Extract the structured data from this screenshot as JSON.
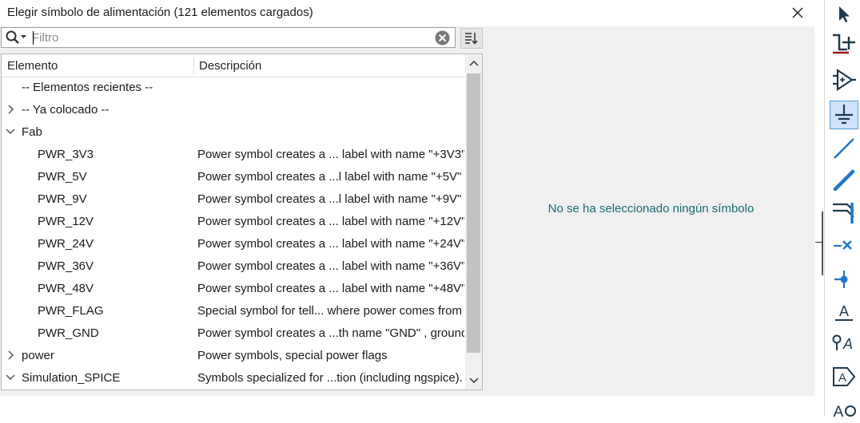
{
  "dialog": {
    "title": "Elegir símbolo de alimentación (121 elementos cargados)"
  },
  "filter": {
    "placeholder": "Filtro",
    "value": ""
  },
  "tree": {
    "columns": [
      "Elemento",
      "Descripción"
    ],
    "rows": [
      {
        "name": "-- Elementos recientes --",
        "desc": "",
        "level": 0,
        "arrow": "none"
      },
      {
        "name": "-- Ya colocado --",
        "desc": "",
        "level": 0,
        "arrow": "collapsed"
      },
      {
        "name": "Fab",
        "desc": "",
        "level": 0,
        "arrow": "expanded"
      },
      {
        "name": "PWR_3V3",
        "desc": "Power symbol creates a ... label with name \"+3V3\"",
        "level": 1,
        "arrow": "none"
      },
      {
        "name": "PWR_5V",
        "desc": "Power symbol creates a ...l label with name \"+5V\"",
        "level": 1,
        "arrow": "none"
      },
      {
        "name": "PWR_9V",
        "desc": "Power symbol creates a ...l label with name \"+9V\"",
        "level": 1,
        "arrow": "none"
      },
      {
        "name": "PWR_12V",
        "desc": "Power symbol creates a ... label with name \"+12V\"",
        "level": 1,
        "arrow": "none"
      },
      {
        "name": "PWR_24V",
        "desc": "Power symbol creates a ... label with name \"+24V\"",
        "level": 1,
        "arrow": "none"
      },
      {
        "name": "PWR_36V",
        "desc": "Power symbol creates a ... label with name \"+36V\"",
        "level": 1,
        "arrow": "none"
      },
      {
        "name": "PWR_48V",
        "desc": "Power symbol creates a ... label with name \"+48V\"",
        "level": 1,
        "arrow": "none"
      },
      {
        "name": "PWR_FLAG",
        "desc": "Special symbol for tell... where power comes from",
        "level": 1,
        "arrow": "none"
      },
      {
        "name": "PWR_GND",
        "desc": "Power symbol creates a ...th name \"GND\" , ground",
        "level": 1,
        "arrow": "none"
      },
      {
        "name": "power",
        "desc": "Power symbols, special power flags",
        "level": 0,
        "arrow": "collapsed"
      },
      {
        "name": "Simulation_SPICE",
        "desc": "Symbols specialized for ...tion (including ngspice).",
        "level": 0,
        "arrow": "expanded"
      }
    ]
  },
  "preview": {
    "message": "No se ha seleccionado ningún símbolo"
  },
  "colors": {
    "accent_text": "#176a73",
    "toolbar_active": "#cfe2f7",
    "icon_dark": "#1f3a4d",
    "icon_blue": "#1f77c9",
    "icon_red": "#a01515"
  },
  "toolbar": {
    "tools": [
      {
        "icon": "select-cursor-icon",
        "active": false
      },
      {
        "icon": "hierarchy-navigate-icon",
        "active": false
      },
      {
        "icon": "add-symbol-icon",
        "active": false
      },
      {
        "icon": "add-power-icon",
        "active": true
      },
      {
        "icon": "add-wire-icon",
        "active": false
      },
      {
        "icon": "add-bus-icon",
        "active": false
      },
      {
        "icon": "bus-entry-icon",
        "active": false
      },
      {
        "icon": "no-connect-icon",
        "active": false
      },
      {
        "icon": "junction-icon",
        "active": false
      },
      {
        "icon": "net-label-icon",
        "active": false
      },
      {
        "icon": "global-label-icon",
        "active": false
      },
      {
        "icon": "hierarchical-label-icon",
        "active": false
      },
      {
        "icon": "text-icon",
        "active": false
      }
    ]
  }
}
